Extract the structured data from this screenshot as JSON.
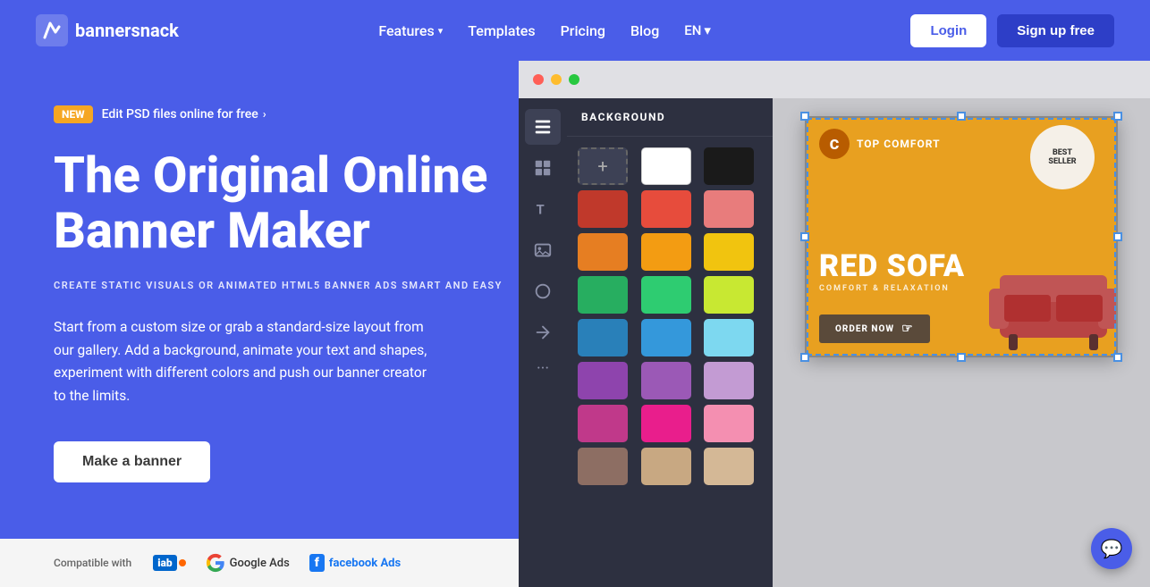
{
  "navbar": {
    "logo_text": "bannersnack",
    "links": [
      {
        "label": "Features",
        "has_dropdown": true
      },
      {
        "label": "Templates",
        "has_dropdown": false
      },
      {
        "label": "Pricing",
        "has_dropdown": false
      },
      {
        "label": "Blog",
        "has_dropdown": false
      },
      {
        "label": "EN",
        "has_dropdown": true
      }
    ],
    "login_label": "Login",
    "signup_label": "Sign up free"
  },
  "hero": {
    "new_badge": "NEW",
    "new_badge_text": "Edit PSD files online for free",
    "title_line1": "The Original Online",
    "title_line2": "Banner Maker",
    "subtitle": "CREATE STATIC VISUALS OR ANIMATED HTML5 BANNER ADS SMART AND EASY",
    "description": "Start from a custom size or grab a standard-size layout from our gallery. Add a background, animate your text and shapes, experiment with different colors and push our banner creator to the limits.",
    "cta_label": "Make a banner",
    "compatible_label": "Compatible with"
  },
  "editor": {
    "panel_title": "BACKGROUND",
    "colors": [
      {
        "hex": "#ffffff",
        "label": "white"
      },
      {
        "hex": "#1a1a1a",
        "label": "black"
      },
      {
        "hex": "#c0392b",
        "label": "dark-red"
      },
      {
        "hex": "#e74c3c",
        "label": "red"
      },
      {
        "hex": "#e87c7c",
        "label": "light-red"
      },
      {
        "hex": "#e67e22",
        "label": "orange"
      },
      {
        "hex": "#f39c12",
        "label": "amber"
      },
      {
        "hex": "#f1c40f",
        "label": "yellow"
      },
      {
        "hex": "#27ae60",
        "label": "green"
      },
      {
        "hex": "#2ecc71",
        "label": "light-green"
      },
      {
        "hex": "#c8e832",
        "label": "lime"
      },
      {
        "hex": "#2980b9",
        "label": "blue"
      },
      {
        "hex": "#3498db",
        "label": "light-blue"
      },
      {
        "hex": "#7dd8f0",
        "label": "sky"
      },
      {
        "hex": "#8e44ad",
        "label": "purple"
      },
      {
        "hex": "#9b59b6",
        "label": "medium-purple"
      },
      {
        "hex": "#c39bd3",
        "label": "lavender"
      },
      {
        "hex": "#c0392b",
        "label": "magenta-dark"
      },
      {
        "hex": "#e91e8c",
        "label": "pink"
      },
      {
        "hex": "#f48fb1",
        "label": "light-pink"
      },
      {
        "hex": "#8d6e63",
        "label": "brown"
      },
      {
        "hex": "#c8a882",
        "label": "tan"
      },
      {
        "hex": "#d4b896",
        "label": "beige"
      }
    ]
  },
  "banner": {
    "brand_letter": "C",
    "top_text": "TOP COMFORT",
    "best": "BEST",
    "seller": "SELLER",
    "title": "RED SOFA",
    "subtitle": "COMFORT & RELAXATION",
    "cta": "ORDER NOW"
  },
  "chat": {
    "icon": "💬"
  }
}
